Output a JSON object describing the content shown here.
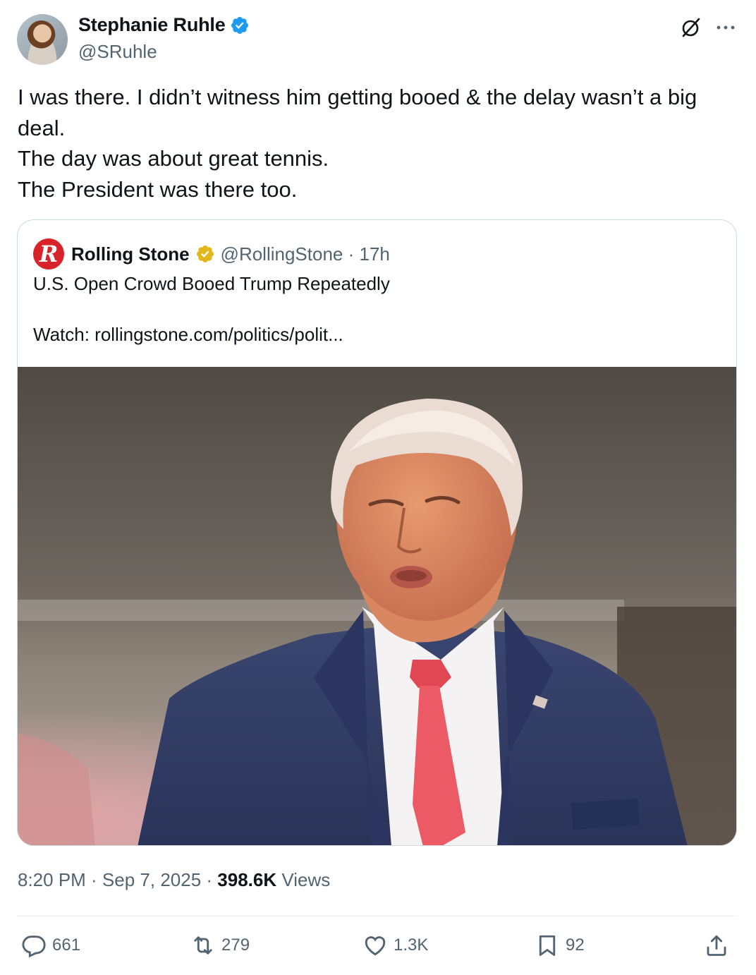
{
  "author": {
    "display_name": "Stephanie Ruhle",
    "handle": "@SRuhle",
    "verified_color": "#1d9bf0"
  },
  "tweet": {
    "lines": [
      "I was there. I didn’t witness him getting booed & the delay wasn’t a big deal.",
      "The day was about great tennis.",
      "The President was there too."
    ]
  },
  "quoted_tweet": {
    "logo_letter": "R",
    "display_name": "Rolling Stone",
    "handle_time": "@RollingStone · 17h",
    "headline": "U.S. Open Crowd Booed Trump Repeatedly",
    "link_line": "Watch: rollingstone.com/politics/polit...",
    "badge_color": "#e2b719"
  },
  "meta": {
    "time_date": "8:20 PM · Sep 7, 2025 · ",
    "views_count": "398.6K",
    "views_label": " Views"
  },
  "actions": {
    "replies": "661",
    "reposts": "279",
    "likes": "1.3K",
    "bookmarks": "92"
  },
  "icons": [
    "verified-icon",
    "grok-icon",
    "more-icon",
    "reply-icon",
    "repost-icon",
    "like-icon",
    "bookmark-icon",
    "share-icon"
  ]
}
